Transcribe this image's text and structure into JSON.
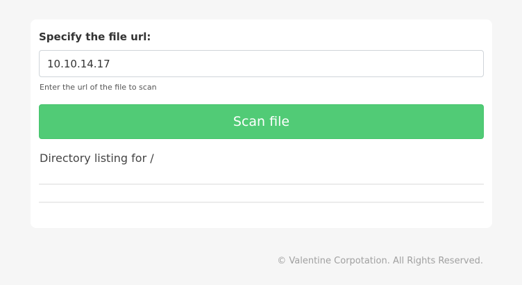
{
  "form": {
    "label": "Specify the file url:",
    "url_value": "10.10.14.17",
    "help_text": "Enter the url of the file to scan",
    "scan_button_label": "Scan file"
  },
  "listing": {
    "heading": "Directory listing for /"
  },
  "footer": {
    "copyright": "© Valentine Corpotation. All Rights Reserved."
  },
  "colors": {
    "page_background": "#f6f6f6",
    "card_background": "#ffffff",
    "button_green": "#51cb76",
    "footer_text": "#a0a0a0"
  }
}
